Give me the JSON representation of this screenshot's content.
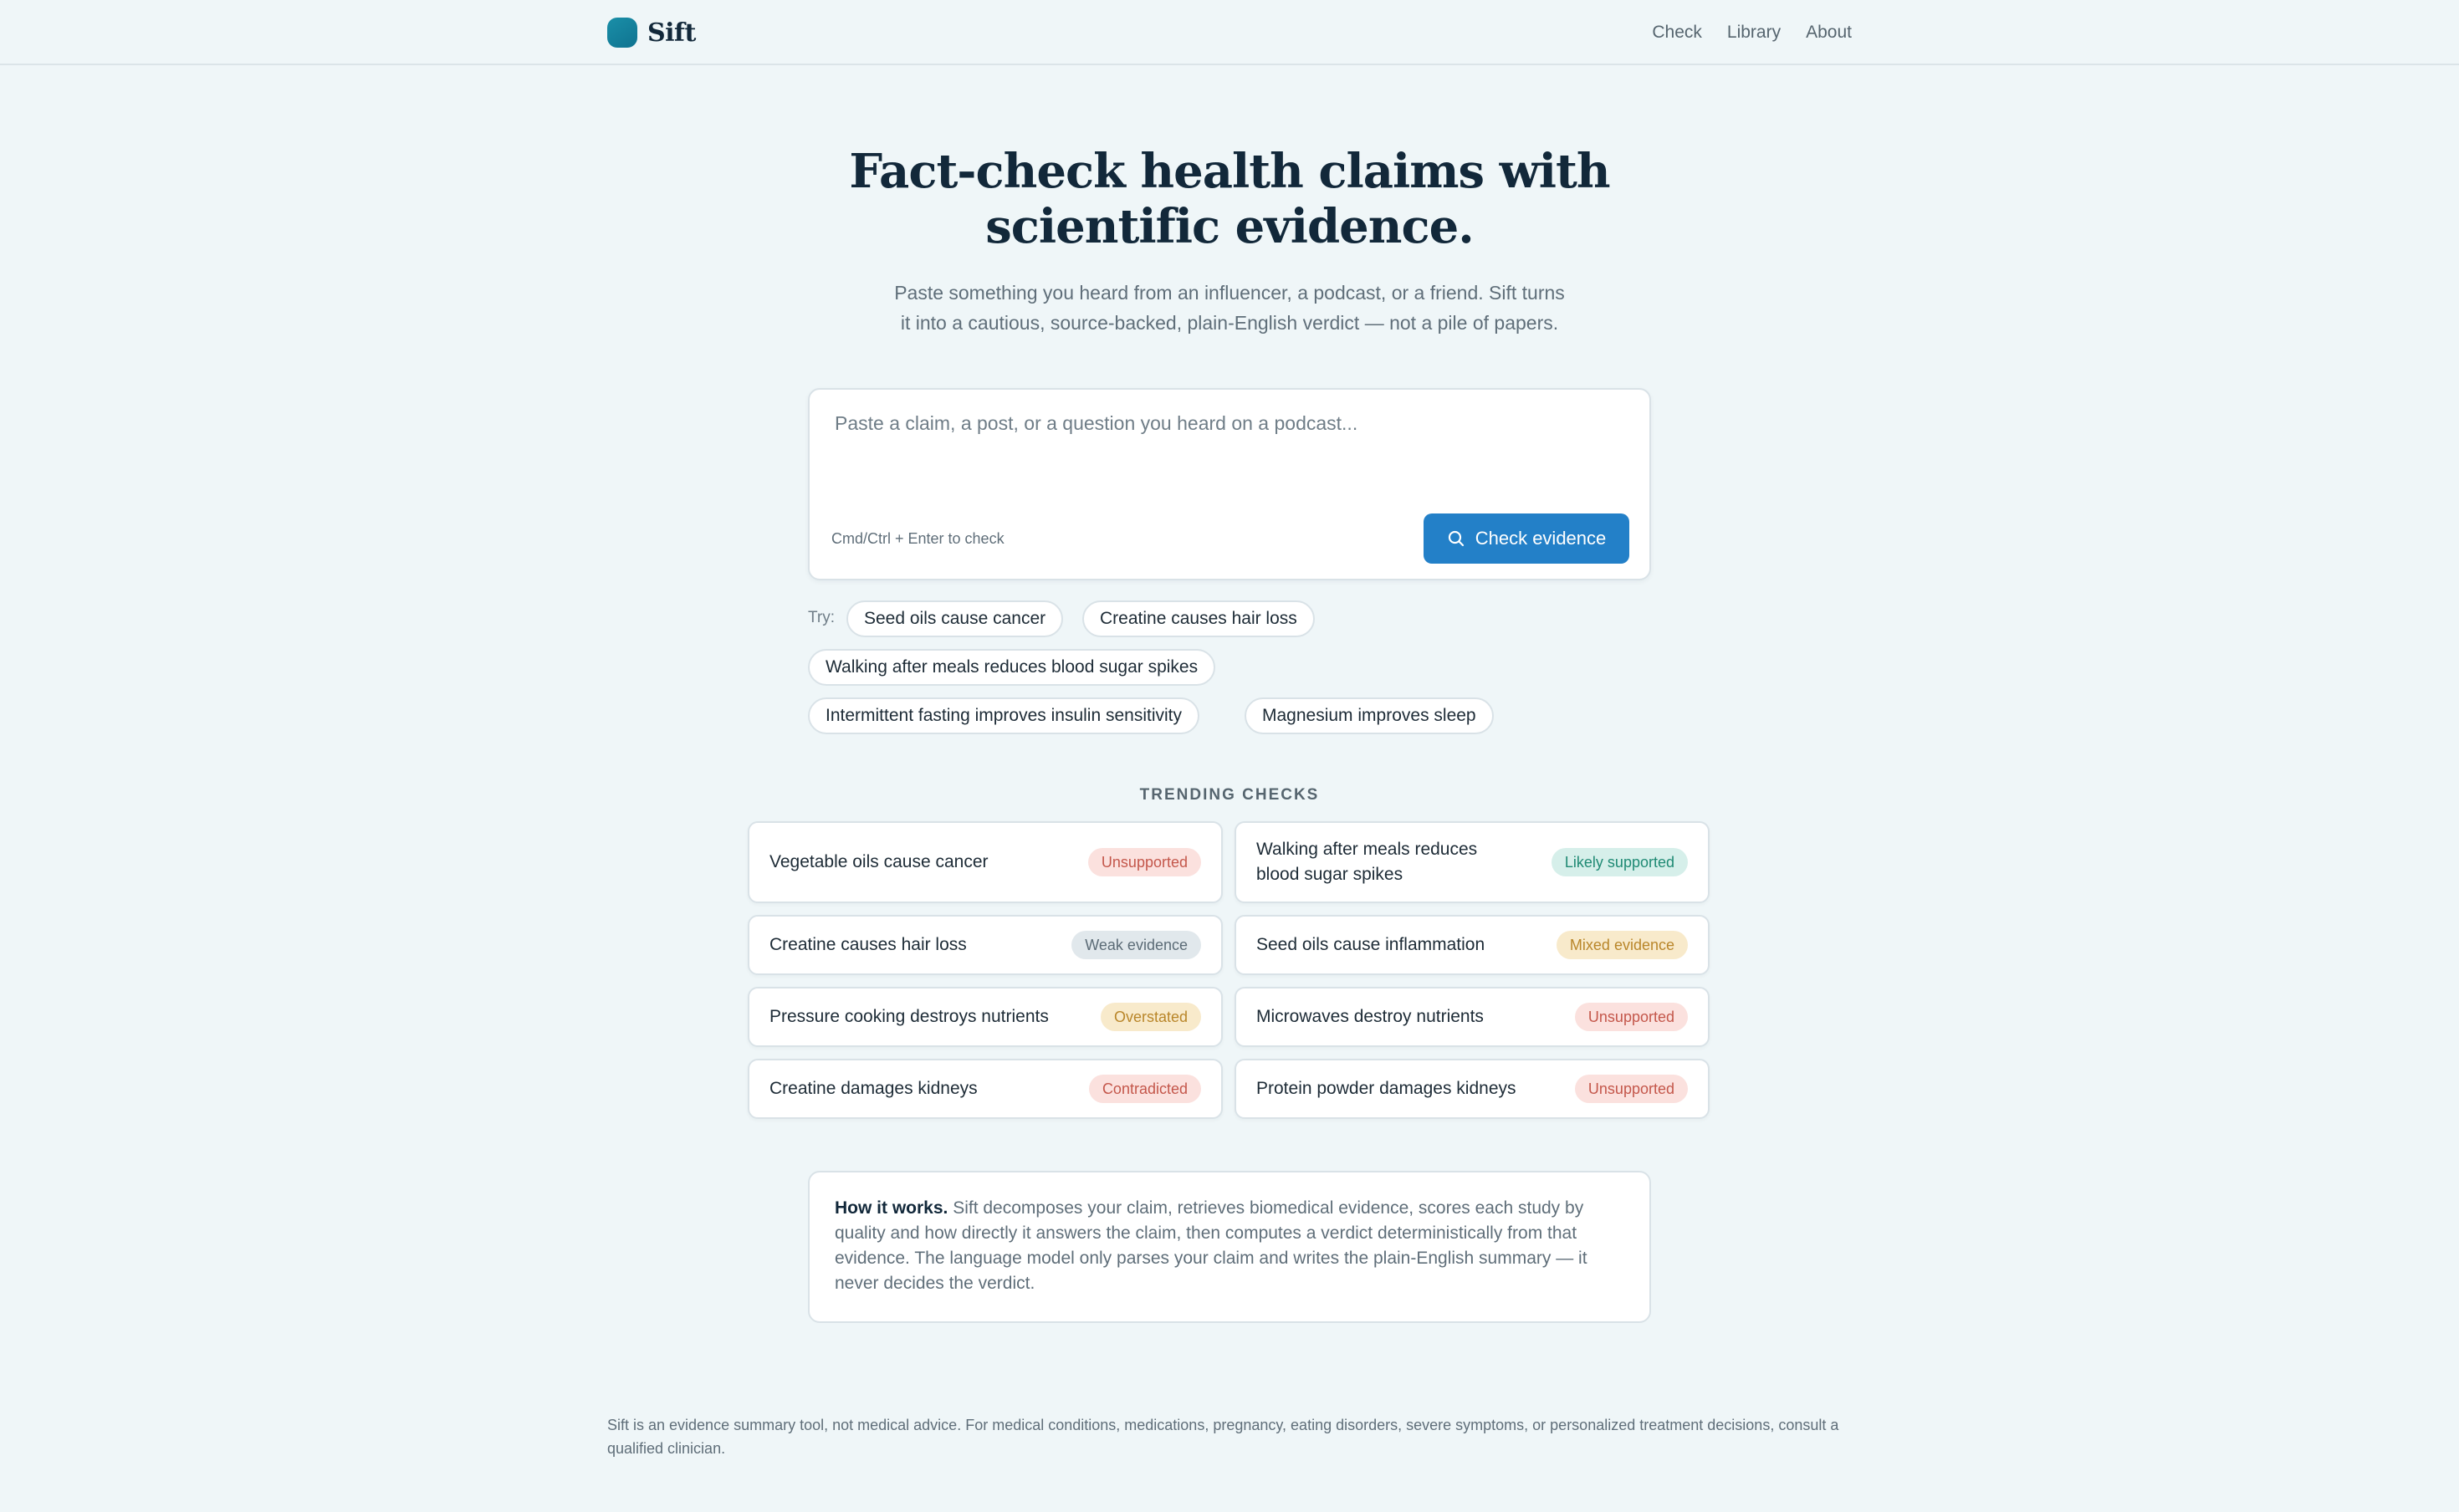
{
  "app": {
    "name": "Sift"
  },
  "nav": {
    "items": [
      "Check",
      "Library",
      "About"
    ]
  },
  "hero": {
    "title_line1": "Fact-check health claims with",
    "title_line2": "scientific evidence.",
    "subtitle_line1": "Paste something you heard from an influencer, a podcast, or a friend. Sift turns",
    "subtitle_line2": "it into a cautious, source-backed, plain-English verdict — not a pile of papers."
  },
  "input": {
    "placeholder": "Paste a claim, a post, or a question you heard on a podcast...",
    "value": "",
    "hint": "Cmd/Ctrl + Enter to check",
    "button_label": "Check evidence",
    "button_icon": "search-icon"
  },
  "suggestions": {
    "label": "Try:",
    "chips": [
      "Seed oils cause cancer",
      "Creatine causes hair loss",
      "Walking after meals reduces blood sugar spikes",
      "Intermittent fasting improves insulin sensitivity",
      "Magnesium improves sleep"
    ]
  },
  "trending": {
    "title": "TRENDING CHECKS",
    "items": [
      {
        "claim": "Vegetable oils cause cancer",
        "verdict": "Unsupported",
        "tone": "unsupported"
      },
      {
        "claim": "Walking after meals reduces blood sugar spikes",
        "verdict": "Likely supported",
        "tone": "likely"
      },
      {
        "claim": "Creatine causes hair loss",
        "verdict": "Weak evidence",
        "tone": "weak"
      },
      {
        "claim": "Seed oils cause inflammation",
        "verdict": "Mixed evidence",
        "tone": "mixed"
      },
      {
        "claim": "Pressure cooking destroys nutrients",
        "verdict": "Overstated",
        "tone": "overstated"
      },
      {
        "claim": "Microwaves destroy nutrients",
        "verdict": "Unsupported",
        "tone": "unsupported"
      },
      {
        "claim": "Creatine damages kidneys",
        "verdict": "Contradicted",
        "tone": "contradicted"
      },
      {
        "claim": "Protein powder damages kidneys",
        "verdict": "Unsupported",
        "tone": "unsupported"
      }
    ]
  },
  "how_it_works": {
    "heading": "How it works.",
    "body": "Sift decomposes your claim, retrieves biomedical evidence, scores each study by quality and how directly it answers the claim, then computes a verdict deterministically from that evidence. The language model only parses your claim and writes the plain-English summary — it never decides the verdict."
  },
  "footer": {
    "disclaimer": "Sift is an evidence summary tool, not medical advice. For medical conditions, medications, pregnancy, eating disorders, severe symptoms, or personalized treatment decisions, consult a qualified clinician."
  },
  "colors": {
    "background": "#eff6f8",
    "accent": "#2380c8",
    "brand": "#1a8fa8",
    "title": "#12283a"
  }
}
